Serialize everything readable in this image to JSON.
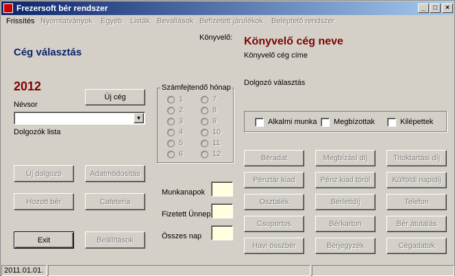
{
  "window": {
    "title": "Frezersoft bér rendszer"
  },
  "menu": [
    "Frissítés",
    "Nyomtatványok",
    "Egyéb",
    "Listák",
    "Bevallások",
    "Befizetett járulékok",
    "Beléptető rendszer"
  ],
  "left": {
    "heading": "Cég választás",
    "year": "2012",
    "new_company": "Új cég",
    "name_list_label": "Névsor",
    "combo_value": "",
    "employees_list_label": "Dolgozók lista",
    "new_employee": "Új dolgozó",
    "data_modify": "Adatmódosítás",
    "carried_wage": "Hozott bér",
    "cafeteria": "Cafeteria",
    "exit": "Exit",
    "settings": "Beállítások"
  },
  "month_group": {
    "label": "Számfejtendő hónap",
    "months": [
      "1",
      "2",
      "3",
      "4",
      "5",
      "6",
      "7",
      "8",
      "9",
      "10",
      "11",
      "12"
    ]
  },
  "days": {
    "workdays_label": "Munkanapok",
    "paid_holiday_label": "Fizetett Ünnep",
    "total_days_label": "Összes nap",
    "workdays_value": "",
    "paid_holiday_value": "",
    "total_days_value": ""
  },
  "right": {
    "accountant_label": "Könyvelő:",
    "company_name": "Könyvelő cég neve",
    "company_address": "Könyvelő cég címe",
    "employee_select_label": "Dolgozó választás",
    "cb_casual": "Alkalmi munka",
    "cb_contracted": "Megbízottak",
    "cb_leavers": "Kilépettek",
    "buttons": [
      "Béradat",
      "Megbízási díj",
      "Titoktartási díj",
      "Pénztár kiad",
      "Pénz kiad töröl",
      "Külföldi napidíj",
      "Osztalék",
      "Bérletidíj",
      "Telefon",
      "Csoportos",
      "Bérkarton",
      "Bér átutalás",
      "Havi összbér",
      "Bérjegyzék",
      "Cégadatok"
    ]
  },
  "status": {
    "date": "2011.01.01."
  },
  "colors": {
    "title_start": "#0a246a",
    "title_end": "#a6caf0",
    "heading_blue": "#0a246a",
    "heading_red": "#800000",
    "face": "#d4d0c8"
  }
}
